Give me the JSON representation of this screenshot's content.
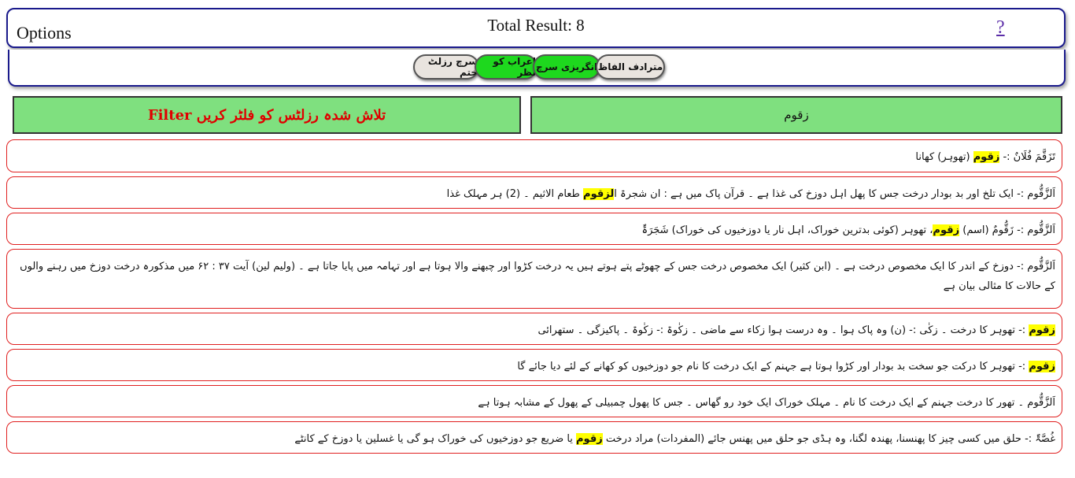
{
  "header": {
    "options_label": "Options",
    "total_label": "Total Result: 8",
    "help_label": "?"
  },
  "toolbar": {
    "buttons": [
      {
        "label": "سرچ رزلٹ ختم",
        "style": "grey"
      },
      {
        "label": "اعراب کو نظر",
        "style": "green"
      },
      {
        "label": "انگریزی سرچ",
        "style": "green"
      },
      {
        "label": "مترادف الفاظ",
        "style": "grey"
      }
    ]
  },
  "filter": {
    "label": "تلاش شدہ رزلٹس کو فلٹر کریں Filter"
  },
  "search": {
    "value": "زقوم"
  },
  "colors": {
    "panel_green": "#7fe07f",
    "button_green": "#1ed81e",
    "highlight": "#ffff00",
    "row_border": "#e02020",
    "header_border": "#1a1a8c",
    "filter_text": "#e00000"
  },
  "results": [
    {
      "before": "تَزَقَّمَ فُلَانٌ :- ",
      "highlight": "زقوم",
      "after": " (تھوہر) کھانا"
    },
    {
      "before": "اَلزَّقُّوم :- ایک تلخ اور بد بودار درخت جس کا پھل اہل دوزخ کی غذا ہے ۔ قرآن پاک میں ہے : ان شجرۃ ا",
      "highlight": "لزقوم",
      "after": " طعام الاثیم ۔ (2) ہر مہلک غذا"
    },
    {
      "before": "اَلزَّقُّوم :- زَقُّومٌ (اسم) ",
      "highlight": "زقوم",
      "after": "، تھوہر (کوئی بدترین خوراک، اہل نار یا دوزخیوں کی خوراک) شَجَرَۃٌ"
    },
    {
      "before": "اَلزَّقُّوم :- دوزخ کے اندر کا ایک مخصوص درخت ہے ۔ (ابن کثیر) ایک مخصوص درخت جس کے چھوٹے پتے ہوتے ہیں یہ درخت کڑوا اور چبھنے والا ہوتا ہے اور تہامہ میں پایا جاتا ہے ۔ (ولیم لین) آیت ۳۷ : ۶۲ میں مذکورہ درخت دوزخ میں رہنے والوں کے حالات کا مثالی بیان ہے",
      "highlight": "",
      "after": ""
    },
    {
      "before": "",
      "highlight": "زقوم",
      "after": " :- تھوہر کا درخت ۔ زکٰی :- (ن) وہ پاک ہوا ۔ وہ درست ہوا زکاء سے ماضی ۔ زکٰوۃ :- زکٰوۃ ۔ پاکیزگی ۔ ستھرائی"
    },
    {
      "before": "",
      "highlight": "زقوم",
      "after": " :- تھوہر کا درکت جو سخت بد بودار اور کڑوا ہوتا ہے جہنم کے ایک درخت کا نام جو دوزخیوں کو کھانے کے لئے دیا جائے گا"
    },
    {
      "before": "اَلزَّقُّوم ۔ تھور کا درخت جہنم کے ایک درخت کا نام ۔ مہلک خوراک ایک خود رو گھاس ۔ جس کا پھول چمبیلی کے پھول کے مشابہ ہوتا ہے",
      "highlight": "",
      "after": ""
    },
    {
      "before": "غُصَّۃٌ :- حلق میں کسی چیز کا پھنسنا، پھندہ لگنا، وہ ہڈی جو حلق میں پھنس جائے (المفردات) مراد درخت ",
      "highlight": "زقوم",
      "after": " یا ضریع جو دوزخیوں کی خوراک ہو گی یا غسلین یا دوزخ کے کانٹے"
    }
  ]
}
